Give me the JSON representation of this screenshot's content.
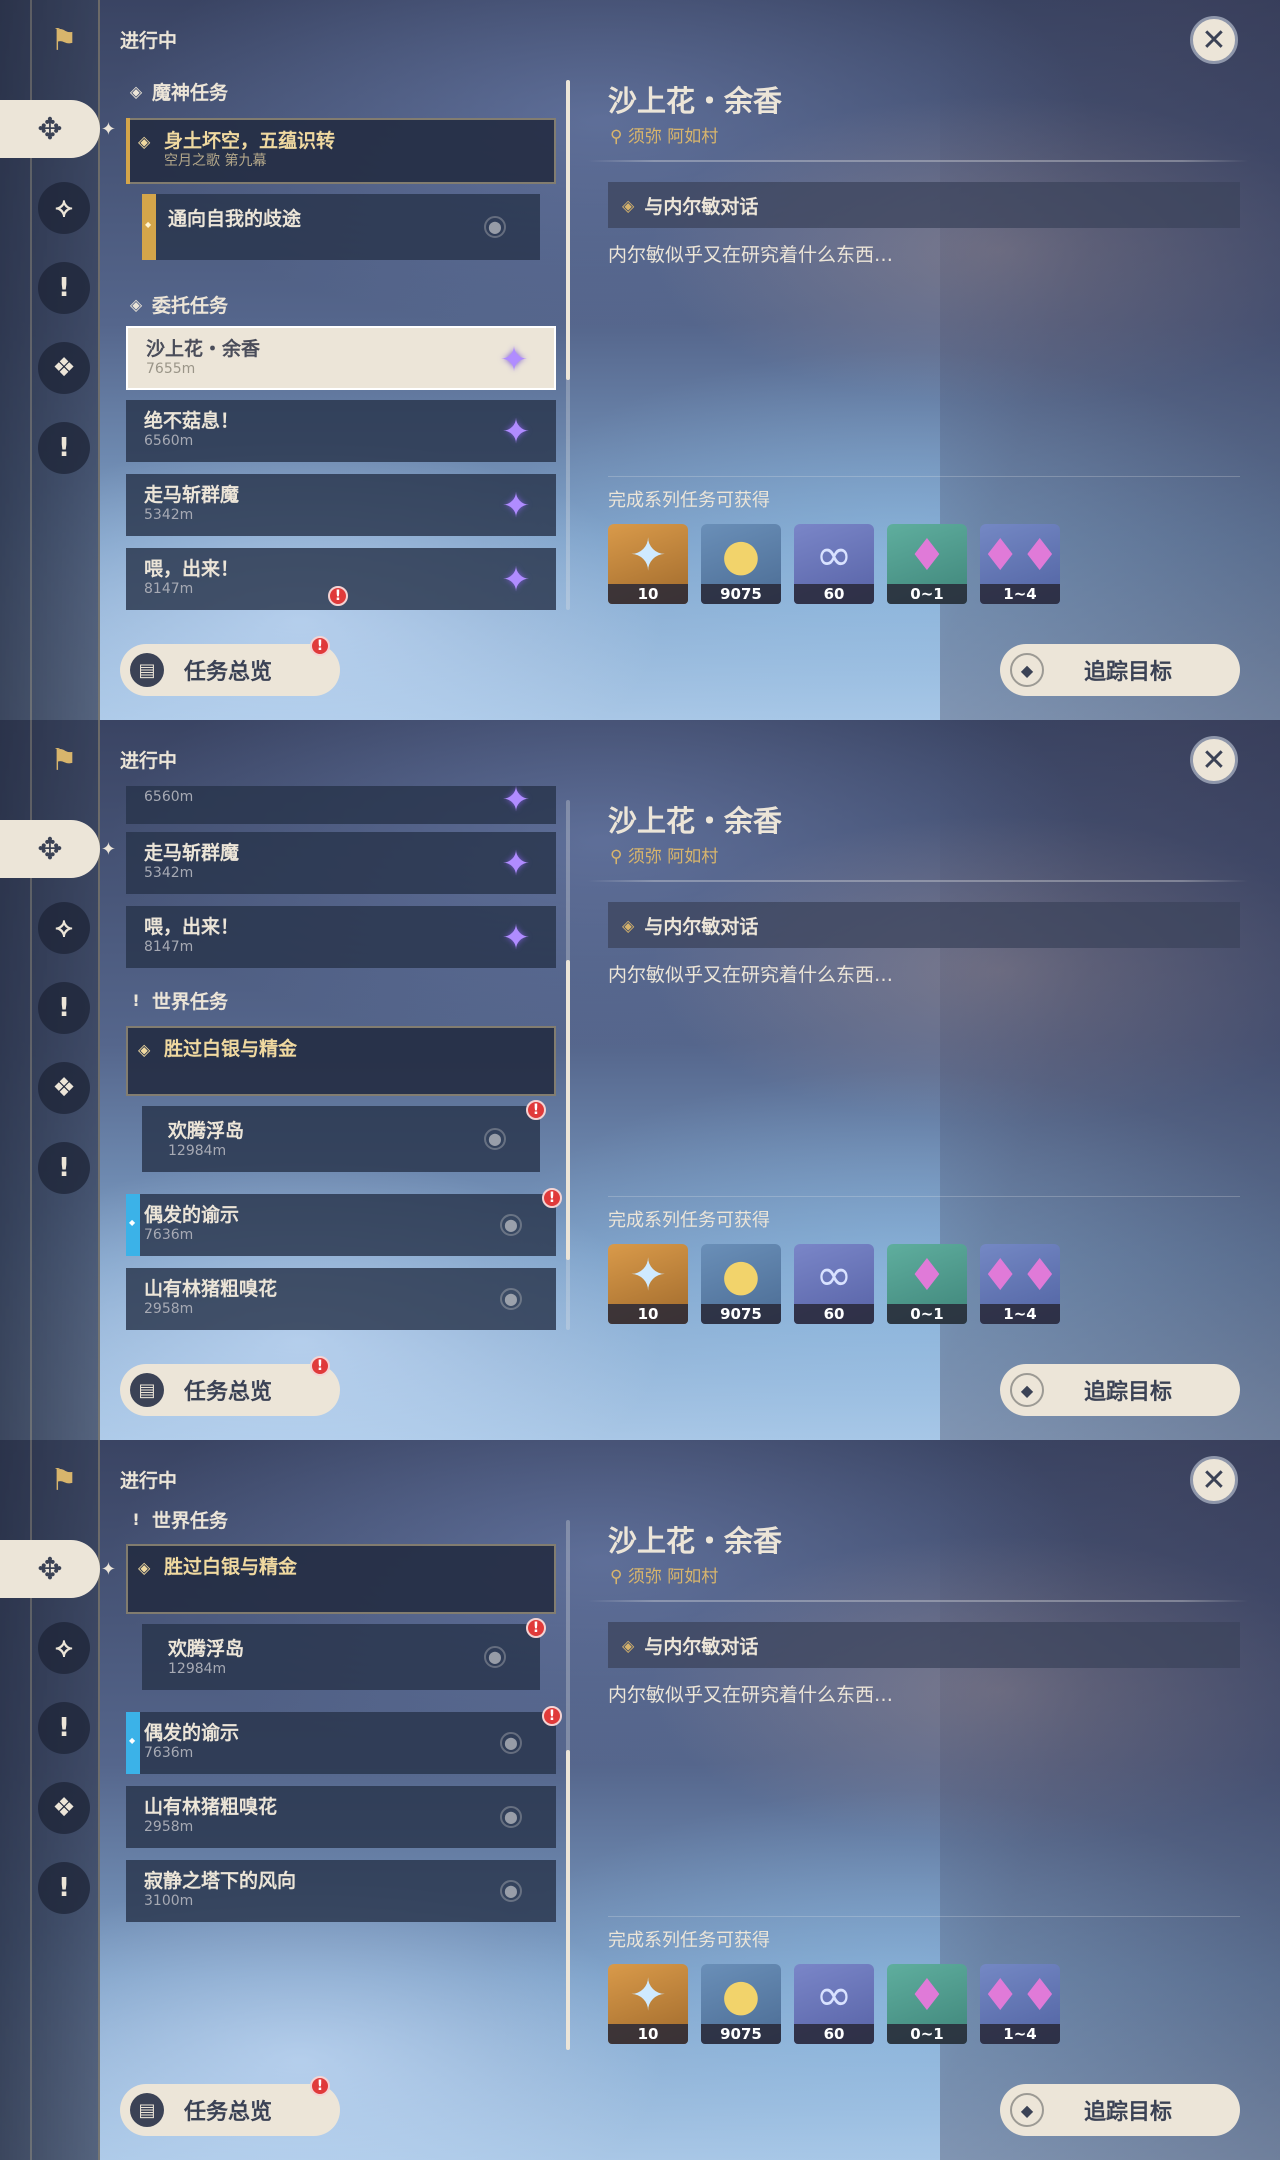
{
  "sidebar": {
    "icons": [
      "bookmark-icon",
      "archon-quest-icon",
      "story-quest-icon",
      "commission-icon",
      "world-quest-icon",
      "event-quest-icon"
    ]
  },
  "header": {
    "status_label": "进行中"
  },
  "detail": {
    "title": "沙上花・余香",
    "location": "须弥 阿如村",
    "step": "与内尔敏对话",
    "description": "内尔敏似乎又在研究着什么东西…",
    "reward_label": "完成系列任务可获得",
    "rewards": [
      {
        "name": "primogem",
        "count": "10",
        "color": "#b9803c"
      },
      {
        "name": "mora",
        "count": "9075",
        "color": "#5b7fa6"
      },
      {
        "name": "fetters",
        "count": "60",
        "color": "#6a77b8"
      },
      {
        "name": "crystal",
        "count": "0~1",
        "color": "#4f9a8d"
      },
      {
        "name": "crystal-cluster",
        "count": "1~4",
        "color": "#6277b3"
      }
    ]
  },
  "buttons": {
    "overview": "任务总览",
    "track": "追踪目标"
  },
  "frame1": {
    "cat_archon": "魔神任务",
    "archon_title": "身土坏空，五蕴识转",
    "archon_sub": "空月之歌 第九幕",
    "archon_child": "通向自我的歧途",
    "cat_commission": "委托任务",
    "items": [
      {
        "title": "沙上花・余香",
        "dist": "7655m"
      },
      {
        "title": "绝不菇息！",
        "dist": "6560m"
      },
      {
        "title": "走马斩群魔",
        "dist": "5342m"
      },
      {
        "title": "喂，出来！",
        "dist": "8147m"
      }
    ]
  },
  "frame2": {
    "partial_dist": "6560m",
    "items": [
      {
        "title": "走马斩群魔",
        "dist": "5342m"
      },
      {
        "title": "喂，出来！",
        "dist": "8147m"
      }
    ],
    "cat_world": "世界任务",
    "world_title": "胜过白银与精金",
    "world_child": {
      "title": "欢腾浮岛",
      "dist": "12984m"
    },
    "others": [
      {
        "title": "偶发的谕示",
        "dist": "7636m"
      },
      {
        "title": "山有林猪粗嗅花",
        "dist": "2958m"
      }
    ]
  },
  "frame3": {
    "cat_world": "世界任务",
    "world_title": "胜过白银与精金",
    "world_child": {
      "title": "欢腾浮岛",
      "dist": "12984m"
    },
    "others": [
      {
        "title": "偶发的谕示",
        "dist": "7636m"
      },
      {
        "title": "山有林猪粗嗅花",
        "dist": "2958m"
      },
      {
        "title": "寂静之塔下的风向",
        "dist": "3100m"
      }
    ]
  }
}
